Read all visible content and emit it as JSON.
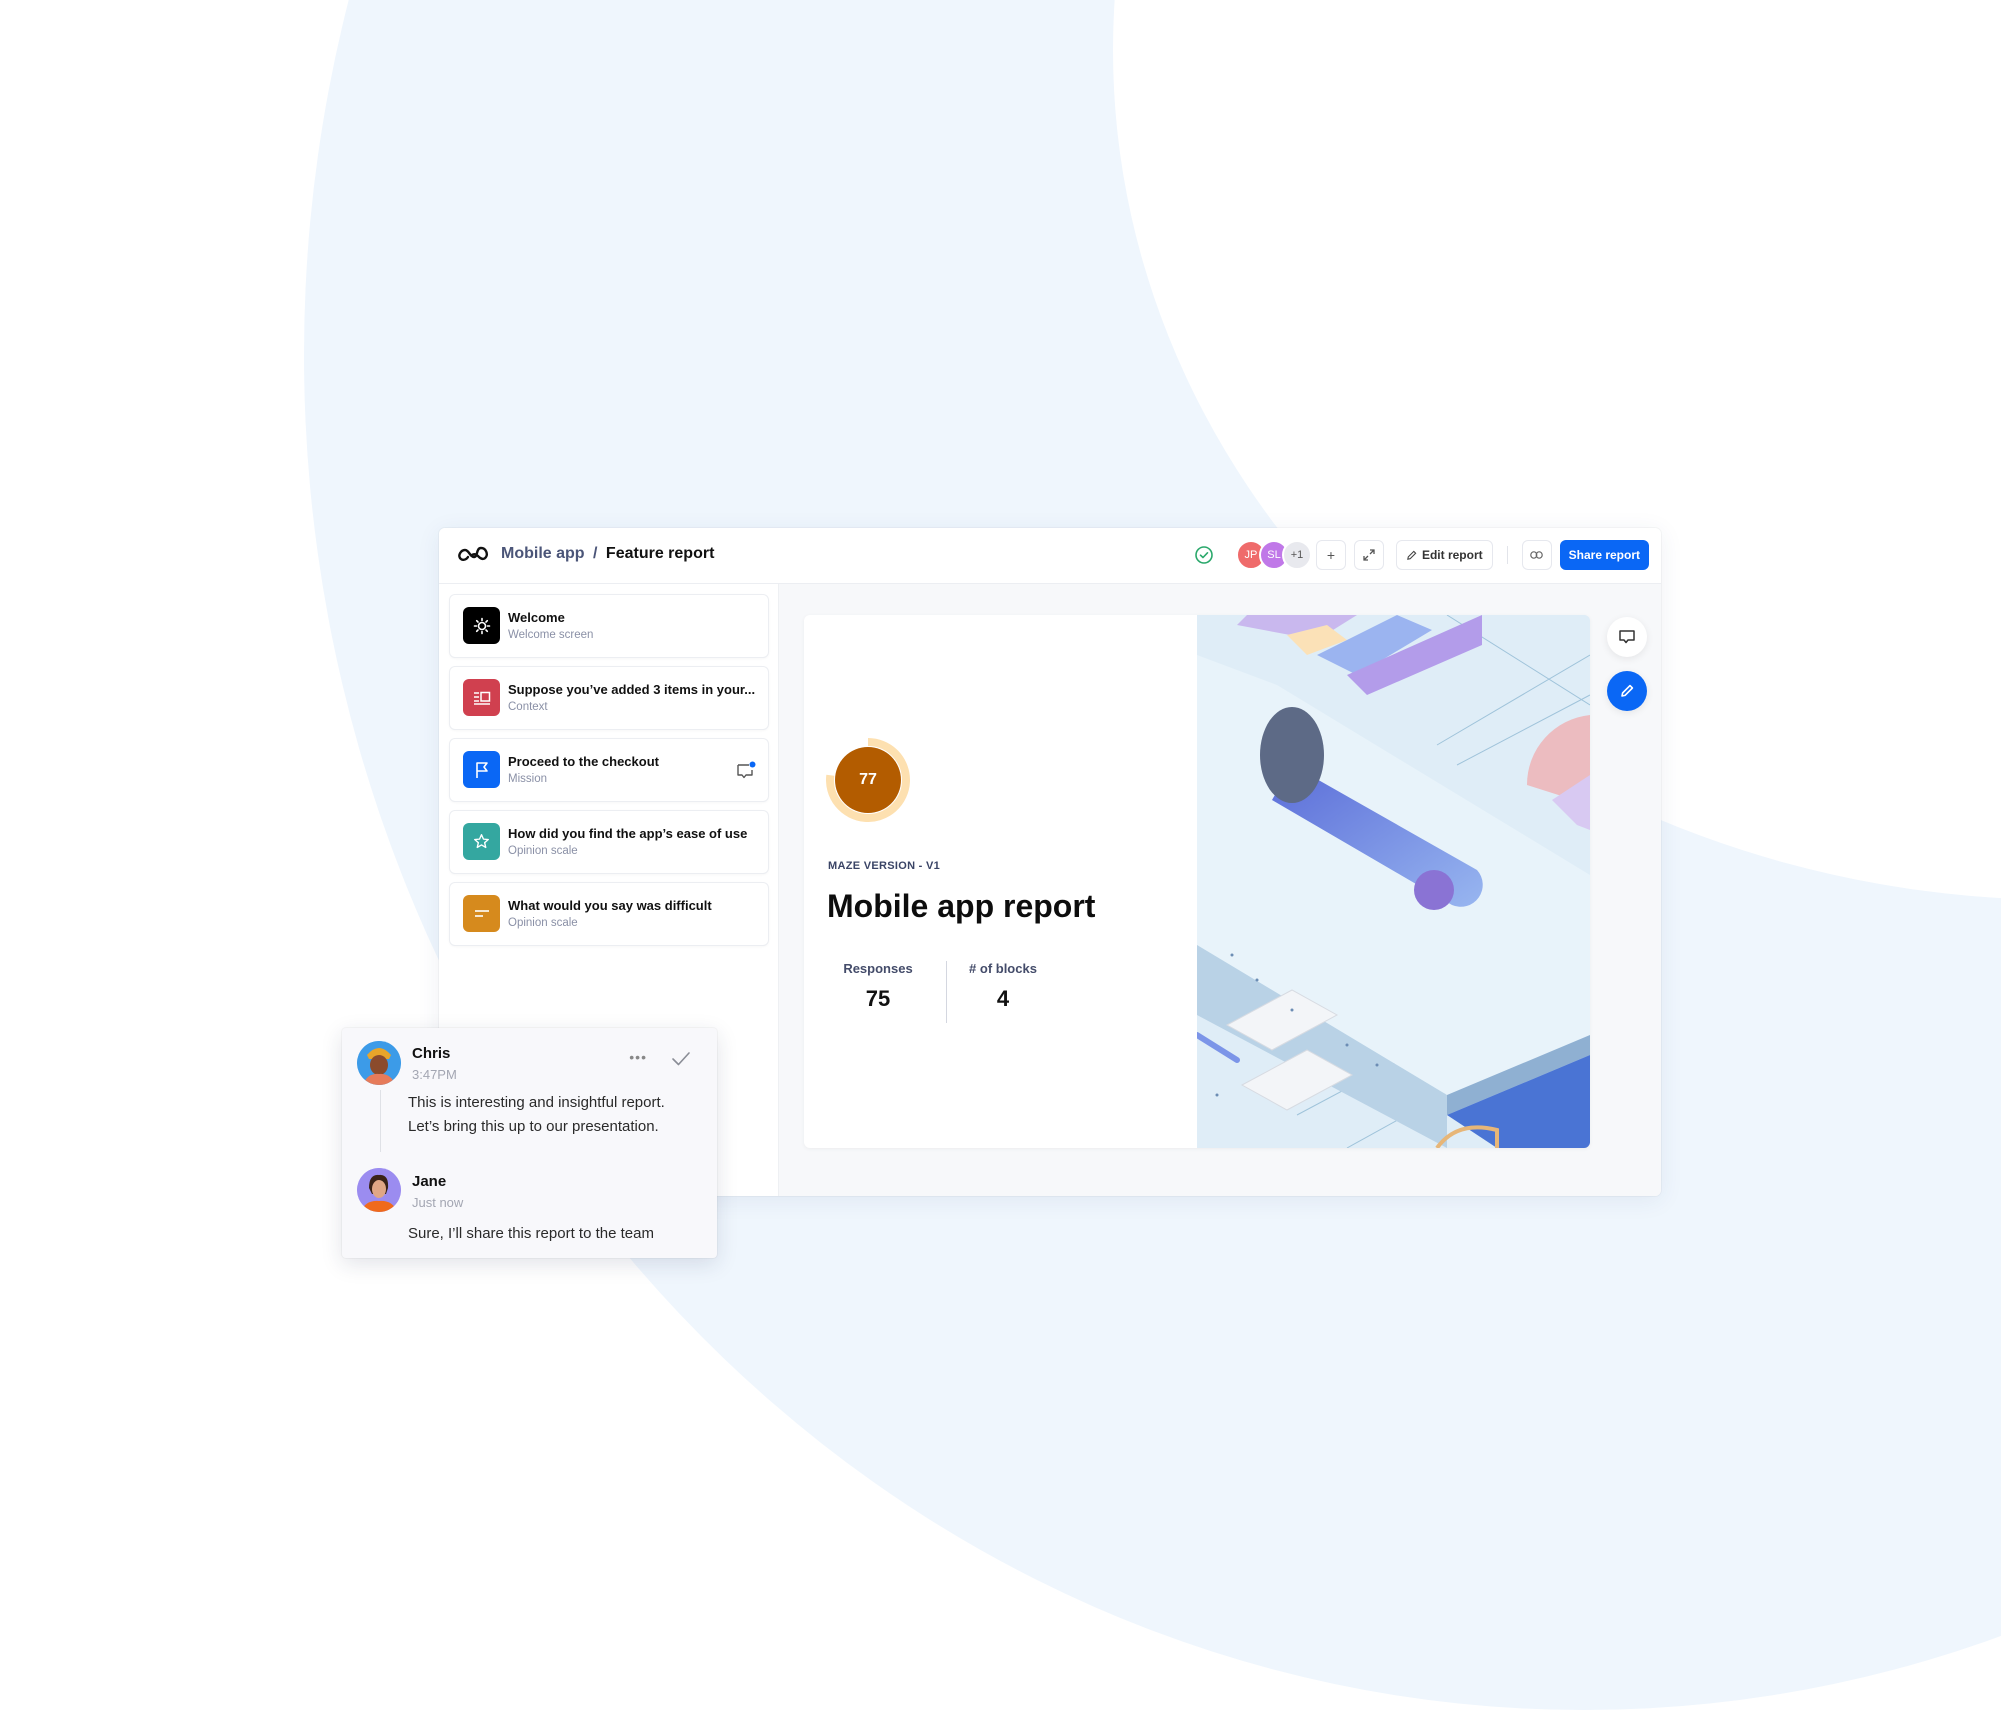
{
  "header": {
    "breadcrumb_parent": "Mobile app",
    "breadcrumb_separator": "/",
    "breadcrumb_current": "Feature report",
    "status_icon": "check-circle-icon",
    "collaborators": [
      {
        "initials": "JP",
        "color": "#ef6b6b"
      },
      {
        "initials": "SL",
        "color": "#c078e8"
      }
    ],
    "more_collaborators": "+1",
    "add_label": "+",
    "edit_label": "Edit report",
    "share_label": "Share report"
  },
  "sidebar": {
    "blocks": [
      {
        "title": "Welcome",
        "subtitle": "Welcome screen",
        "icon": "sun-icon",
        "color": "#000000"
      },
      {
        "title": "Suppose you’ve added 3 items in your...",
        "subtitle": "Context",
        "icon": "context-icon",
        "color": "#d0404f"
      },
      {
        "title": "Proceed to the checkout",
        "subtitle": "Mission",
        "icon": "flag-icon",
        "color": "#0a67f5",
        "has_comment": true
      },
      {
        "title": "How did you find the app’s ease of use",
        "subtitle": "Opinion scale",
        "icon": "star-icon",
        "color": "#34a7a0"
      },
      {
        "title": "What would you say was difficult",
        "subtitle": "Opinion scale",
        "icon": "text-icon",
        "color": "#d68a1d"
      }
    ]
  },
  "report": {
    "score": "77",
    "score_fraction": 0.77,
    "version": "MAZE VERSION - V1",
    "title": "Mobile app report",
    "stats": [
      {
        "label": "Responses",
        "value": "75"
      },
      {
        "label": "# of blocks",
        "value": "4"
      }
    ]
  },
  "comments": [
    {
      "author": "Chris",
      "time": "3:47PM",
      "lines": [
        "This is interesting and insightful report.",
        "Let’s bring this up to our presentation."
      ]
    },
    {
      "author": "Jane",
      "time": "Just now",
      "lines": [
        "Sure, I’ll share this report to the team"
      ]
    }
  ],
  "colors": {
    "accent": "#0a67f5",
    "score_fill": "#b35c00",
    "score_ring": "#fde0b0"
  }
}
